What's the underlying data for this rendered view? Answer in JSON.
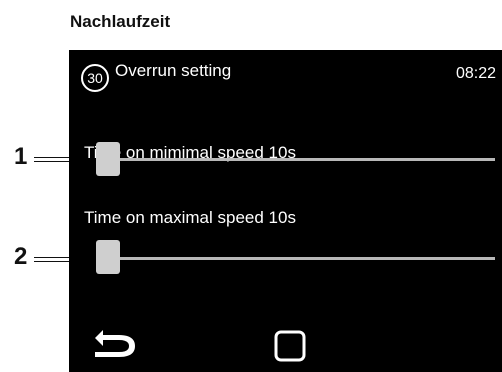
{
  "document": {
    "heading": "Nachlaufzeit"
  },
  "header": {
    "screen_number": "30",
    "title": "Overrun setting",
    "time": "08:22"
  },
  "sliders": [
    {
      "label": "Time on mimimal speed 10s",
      "callout": "1",
      "value_fraction": 0.0
    },
    {
      "label": "Time on maximal speed 10s",
      "callout": "2",
      "value_fraction": 0.0
    }
  ],
  "footer": {
    "icons": [
      "back-arrow-icon",
      "home-square-icon"
    ]
  },
  "colors": {
    "screen_bg": "#000000",
    "text": "#ffffff",
    "track": "#b8b8b8",
    "thumb": "#cfcfcf"
  }
}
